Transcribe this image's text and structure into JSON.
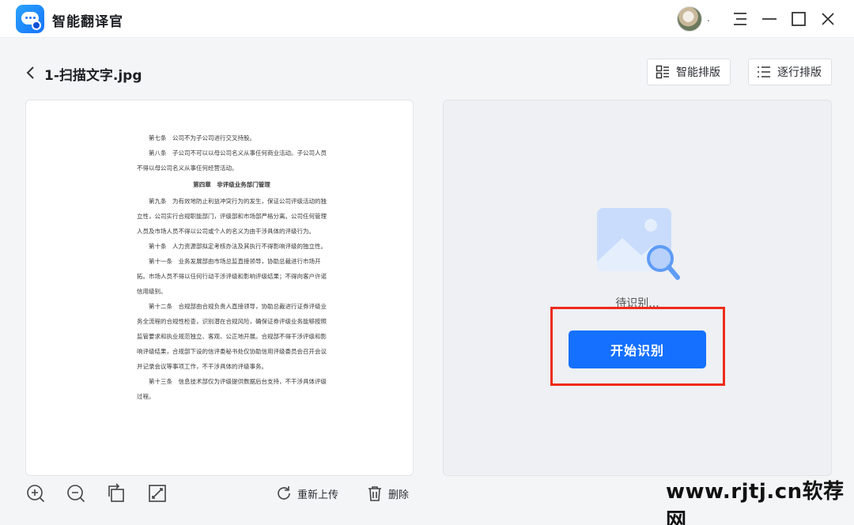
{
  "app": {
    "title": "智能翻译官",
    "user_name": "."
  },
  "header": {
    "file_name": "1-扫描文字.jpg",
    "smart_layout_label": "智能排版",
    "line_layout_label": "逐行排版"
  },
  "document": {
    "paragraphs": [
      "第七条　公司不为子公司进行交叉持股。",
      "第八条　子公司不可以以母公司名义从事任何商业活动。子公司人员不得以母公司名义从事任何经营活动。",
      "第四章　非评级业务部门管理",
      "第九条　为有效地防止利益冲突行为的发生，保证公司评级活动的独立性，公司实行合规职能部门，评级部和市场部严格分离。公司任何管理人员及市场人员不得以公司或个人的名义为由干涉具体的评级行为。",
      "第十条　人力资源部拟定考核办法及其执行不得影响评级的独立性。",
      "第十一条　业务发展部由市场总监直接领导，协助总裁进行市场开拓。市场人员不得以任何行动干涉评级和影响评级结果；不得向客户许诺信用级别。",
      "第十二条　合规部由合规负责人直接领导，协助总裁进行证券评级业务全流程的合规性检查，识别潜在合规风险，确保证券评级业务能够按照监管要求和执业规范独立、客观、公正地开展。合规部不得干涉评级和影响评级结果，合规部下设的信评委秘书处仅协助信用评级委员会召开会议并记录会议等事项工作，不干涉具体的评级事务。",
      "第十三条　信息技术部仅为评级提供数据后台支持，不干涉具体评级过程。"
    ]
  },
  "toolbar": {
    "reupload_label": "重新上传",
    "delete_label": "删除"
  },
  "result": {
    "status": "待识别...",
    "start_button": "开始识别"
  },
  "watermark": "www.rjtj.cn软荐网",
  "colors": {
    "accent": "#1570ff",
    "highlight": "#ee2b1b"
  }
}
